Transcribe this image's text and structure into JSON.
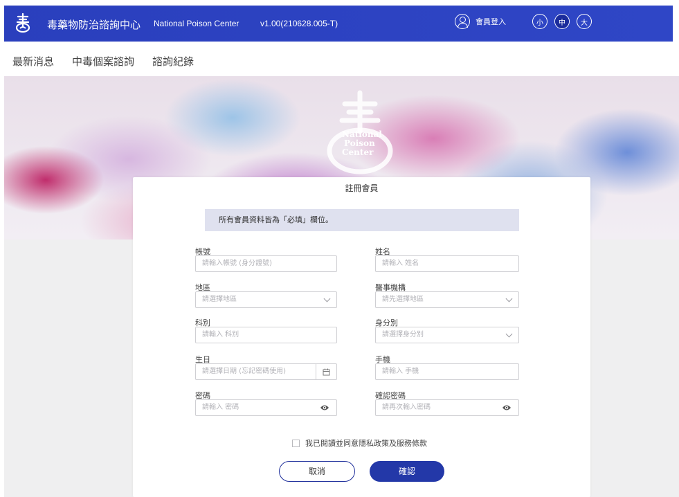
{
  "header": {
    "brand": "毒藥物防治諮詢中心",
    "brand_en": "National Poison Center",
    "version": "v1.00(210628.005-T)",
    "login_label": "會員登入",
    "font_sizes": [
      "小",
      "中",
      "大"
    ],
    "active_font_size": "中"
  },
  "nav": {
    "items": [
      "最新消息",
      "中毒個案諮詢",
      "諮詢紀錄"
    ]
  },
  "hero": {
    "logo_text": [
      "National",
      "Poison",
      "Center"
    ]
  },
  "form": {
    "title": "註冊會員",
    "notice": "所有會員資料皆為「必填」欄位。",
    "fields": {
      "account": {
        "label": "帳號",
        "placeholder": "請輸入帳號 (身分證號)"
      },
      "name": {
        "label": "姓名",
        "placeholder": "請輸入 姓名"
      },
      "region": {
        "label": "地區",
        "placeholder": "請選擇地區"
      },
      "institution": {
        "label": "醫事機構",
        "placeholder": "請先選擇地區"
      },
      "department": {
        "label": "科別",
        "placeholder": "請輸入 科別"
      },
      "identity": {
        "label": "身分別",
        "placeholder": "請選擇身分別"
      },
      "birthday": {
        "label": "生日",
        "placeholder": "請選擇日期 (忘記密碼使用)"
      },
      "mobile": {
        "label": "手機",
        "placeholder": "請輸入 手機"
      },
      "password": {
        "label": "密碼",
        "placeholder": "請輸入 密碼"
      },
      "confirm_password": {
        "label": "確認密碼",
        "placeholder": "請再次輸入密碼"
      }
    },
    "agree_text": "我已閱讀並同意隱私政策及服務條款",
    "agree_checked": false,
    "cancel_label": "取消",
    "confirm_label": "確認"
  },
  "colors": {
    "header_bg": "#2f46c6",
    "primary_button": "#2338a8",
    "notice_bg": "#dfe1ef",
    "page_band": "#efeff0"
  }
}
